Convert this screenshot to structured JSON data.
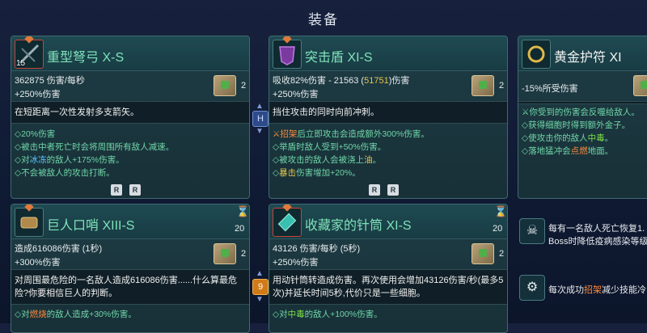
{
  "screen_title": "装备",
  "cards": {
    "crossbow": {
      "name": "重型弩弓 X-S",
      "level": "15",
      "stat1": "362875 伤害/每秒",
      "stat2": "+250%伤害",
      "count": "2",
      "desc": "在短距离一次性发射多支箭矢。",
      "b1": "◇20%伤害",
      "b2": "◇被击中者死亡时会将周围所有敌人减速。",
      "b3a": "◇对",
      "b3b": "冰冻",
      "b3c": "的敌人+175%伤害。",
      "b4": "◇不会被敌人的攻击打断。",
      "btn1": "R",
      "btn2": "R"
    },
    "shield": {
      "name": "突击盾 XI-S",
      "stat1a": "吸收82%伤害 - 21563 (",
      "stat1b": "51751",
      "stat1c": ")伤害",
      "stat2": "+250%伤害",
      "count": "2",
      "desc": "挡住攻击的同时向前冲刺。",
      "b1a": "⚔",
      "b1b": "招架",
      "b1c": "后立即攻击会造成额外300%伤害。",
      "b2": "◇举盾时敌人受到+50%伤害。",
      "b3a": "◇被攻击的敌人会被浇上",
      "b3b": "油",
      "b3c": "。",
      "b4a": "◇",
      "b4b": "暴击",
      "b4c": "伤害增加+20%。",
      "btn1": "R",
      "btn2": "R"
    },
    "amulet": {
      "name": "黄金护符 XI",
      "stat1": "-15%所受伤害",
      "b1": "⚔你受到的伤害会反噬给敌人。",
      "b2": "◇获得细胞时得到额外金子。",
      "b3a": "◇使攻击你的敌人",
      "b3b": "中毒",
      "b3c": "。",
      "b4a": "◇落地猛冲会",
      "b4b": "点燃",
      "b4c": "地面。"
    },
    "whistle": {
      "name": "巨人口哨 XIII-S",
      "cooldown": "20",
      "stat1": "造成616086伤害 (1秒)",
      "stat2": "+300%伤害",
      "count": "2",
      "desc": "对周围最危险的一名敌人造成616086伤害......什么算最危险?你要相信巨人的判断。",
      "b1a": "◇对",
      "b1b": "燃烧",
      "b1c": "的敌人造成+30%伤害。"
    },
    "needle": {
      "name": "收藏家的针筒 XI-S",
      "cooldown": "20",
      "stat1": "43126 伤害/每秒 (5秒)",
      "stat2": "+250%伤害",
      "count": "2",
      "desc": "用动针筒转造成伤害。再次使用会增加43126伤害/秒(最多5次)并延长时间5秒,代价只是一些细胞。",
      "b1a": "◇对",
      "b1b": "中毒",
      "b1c": "的敌人+100%伤害。"
    }
  },
  "center_icons": {
    "top": "H",
    "bottom": "9"
  },
  "side": {
    "item1_line1": "每有一名敌人死亡恢复1.",
    "item1_line2": "Boss时降低疫病感染等级",
    "item2_a": "每次成功",
    "item2_b": "招架",
    "item2_c": "减少技能冷"
  },
  "colors": {
    "accent_green": "#7fe2b9",
    "highlight_yellow": "#e6c84a",
    "orange": "#ff8a3a"
  }
}
